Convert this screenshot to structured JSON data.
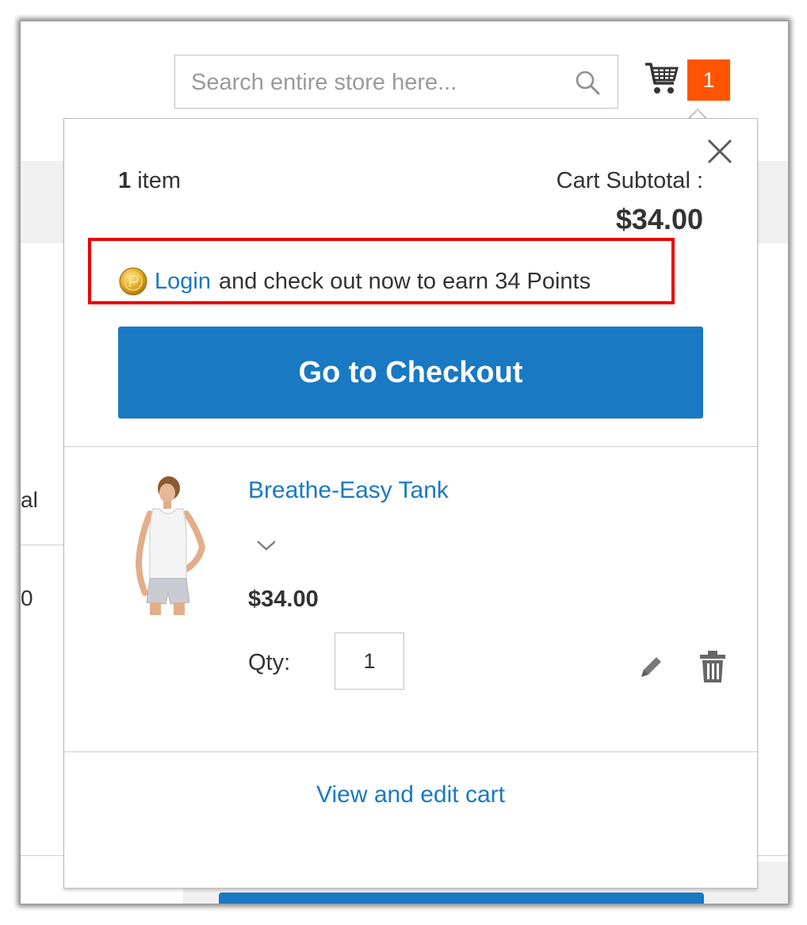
{
  "header": {
    "search": {
      "placeholder": "Search entire store here...",
      "value": ""
    },
    "cart": {
      "count": "1"
    }
  },
  "background": {
    "partial_text_1": "al",
    "partial_text_2": "0"
  },
  "minicart": {
    "items_count": "1",
    "items_label": " item",
    "subtotal_label": "Cart Subtotal :",
    "subtotal_value": "$34.00",
    "points": {
      "login_label": "Login",
      "message": "and check out now to earn 34 Points"
    },
    "checkout_label": "Go to Checkout",
    "items": [
      {
        "name": "Breathe-Easy Tank",
        "price": "$34.00",
        "qty_label": "Qty:",
        "qty": "1"
      }
    ],
    "view_cart_label": "View and edit cart"
  },
  "colors": {
    "accent": "#1979c3",
    "badge": "#ff5501",
    "highlight_box": "#ee0000"
  }
}
